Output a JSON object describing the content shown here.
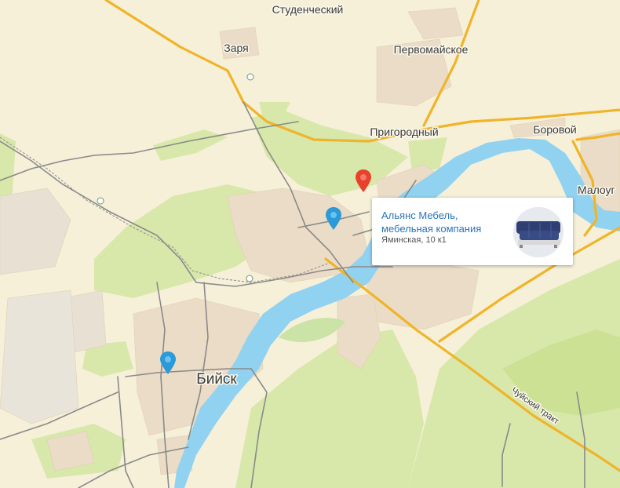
{
  "map": {
    "labels": {
      "studencheskiy": "Студенческий",
      "zarya": "Заря",
      "pervomayskoe": "Первомайское",
      "prigorodnyy": "Пригородный",
      "borovoy": "Боровой",
      "malougl": "Малоуг",
      "biysk": "Бийск",
      "chuyskiy_trakt": "Чуйский тракт"
    },
    "colors": {
      "background": "#f6f0d9",
      "forest": "#d7e6a8",
      "forest_dark": "#c9df92",
      "river": "#8fd0f0",
      "city_block": "#e9dcc7",
      "highway": "#f0b429",
      "road": "#7d7d7d",
      "pin_selected": "#e8412c",
      "pin": "#2a9ad8"
    },
    "markers": [
      {
        "name": "Аlьянс pin",
        "icon": "map-pin-red-icon"
      },
      {
        "name": "pin-2",
        "icon": "map-pin-blue-icon"
      },
      {
        "name": "pin-3",
        "icon": "map-pin-blue-icon"
      }
    ]
  },
  "popup": {
    "title": "Альянс Мебель, мебельная компания",
    "address": "Яминская, 10 к1",
    "thumbnail_icon": "sofa-photo"
  }
}
